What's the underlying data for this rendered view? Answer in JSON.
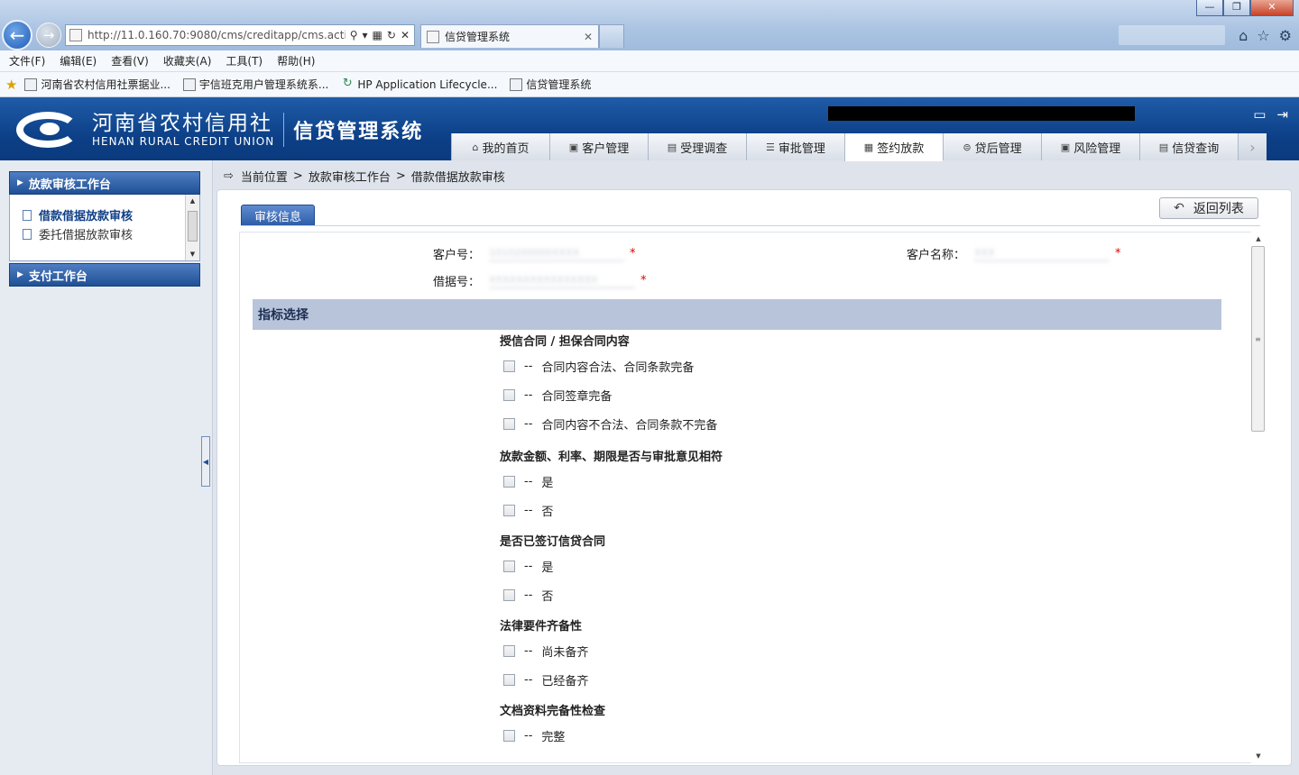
{
  "browser": {
    "address": "http://11.0.160.70:9080/cms/creditapp/cms.actic",
    "tab_title": "信贷管理系统",
    "window_buttons": {
      "minimize": "—",
      "restore": "❐",
      "close": "✕"
    },
    "menu": [
      "文件(F)",
      "编辑(E)",
      "查看(V)",
      "收藏夹(A)",
      "工具(T)",
      "帮助(H)"
    ],
    "favorites": [
      "河南省农村信用社票据业...",
      "宇信班克用户管理系统系...",
      "HP Application Lifecycle...",
      "信贷管理系统"
    ]
  },
  "header": {
    "logo_cn": "河南省农村信用社",
    "logo_en": "HENAN RURAL CREDIT UNION",
    "system_name": "信贷管理系统",
    "nav": [
      {
        "label": "我的首页",
        "icon": "home-icon",
        "glyph": "⌂"
      },
      {
        "label": "客户管理",
        "icon": "customer-icon",
        "glyph": "▣"
      },
      {
        "label": "受理调查",
        "icon": "survey-icon",
        "glyph": "▤"
      },
      {
        "label": "审批管理",
        "icon": "approval-icon",
        "glyph": "☰"
      },
      {
        "label": "签约放款",
        "icon": "contract-icon",
        "glyph": "▦"
      },
      {
        "label": "贷后管理",
        "icon": "postloan-icon",
        "glyph": "⊜"
      },
      {
        "label": "风险管理",
        "icon": "risk-icon",
        "glyph": "▣"
      },
      {
        "label": "信贷查询",
        "icon": "query-icon",
        "glyph": "▤"
      }
    ],
    "active_nav": "签约放款"
  },
  "sidebar": {
    "panel1_title": "放款审核工作台",
    "items": [
      "借款借据放款审核",
      "委托借据放款审核"
    ],
    "active_item": "借款借据放款审核",
    "panel2_title": "支付工作台"
  },
  "breadcrumb": [
    "当前位置",
    "放款审核工作台",
    "借款借据放款审核"
  ],
  "main": {
    "section_tab": "审核信息",
    "back_button": "返回列表",
    "fields": {
      "customer_no_label": "客户号：",
      "customer_no_value": "1010200000XXXX",
      "customer_name_label": "客户名称：",
      "customer_name_value": "XXX",
      "receipt_no_label": "借据号：",
      "receipt_no_value": "XXXXXXXXXXXXXXXX"
    },
    "required_mark": "*",
    "indicator_title": "指标选择",
    "dash": "--",
    "questions": [
      {
        "title": "授信合同 / 担保合同内容",
        "options": [
          "合同内容合法、合同条款完备",
          "合同签章完备",
          "合同内容不合法、合同条款不完备"
        ]
      },
      {
        "title": "放款金额、利率、期限是否与审批意见相符",
        "options": [
          "是",
          "否"
        ]
      },
      {
        "title": "是否已签订信贷合同",
        "options": [
          "是",
          "否"
        ]
      },
      {
        "title": "法律要件齐备性",
        "options": [
          "尚未备齐",
          "已经备齐"
        ]
      },
      {
        "title": "文档资料完备性检查",
        "options": [
          "完整"
        ]
      }
    ]
  }
}
